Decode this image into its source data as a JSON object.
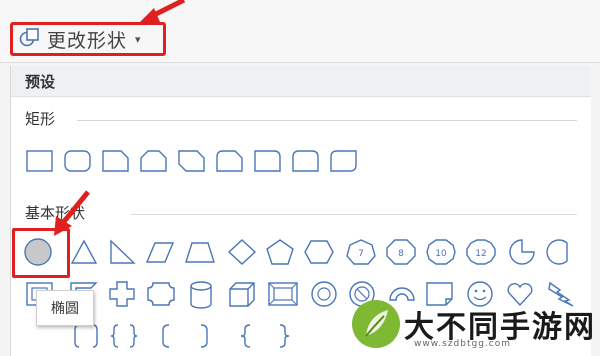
{
  "toolbar": {
    "change_shape_label": "更改形状",
    "dropdown_caret": "▾"
  },
  "panel": {
    "header": "预设",
    "sections": [
      {
        "title": "矩形"
      },
      {
        "title": "基本形状"
      }
    ]
  },
  "tooltip": {
    "text": "椭圆"
  },
  "watermark": {
    "title": "大不同手游网",
    "url": "www.szdbtgg.com"
  },
  "colors": {
    "highlight": "#e02020",
    "shape_stroke": "#4a76b8",
    "selected_fill": "#c8c8c8"
  },
  "icons": {
    "rectangle_shapes": [
      "rectangle-icon",
      "rounded-rectangle-icon",
      "snip-single-corner-rectangle-icon",
      "snip-same-side-corner-rectangle-icon",
      "snip-diagonal-corner-rectangle-icon",
      "snip-round-single-corner-rectangle-icon",
      "round-single-corner-rectangle-icon",
      "round-same-side-corner-rectangle-icon",
      "round-diagonal-corner-rectangle-icon"
    ],
    "basic_shapes_row1": [
      "oval-icon",
      "isosceles-triangle-icon",
      "right-triangle-icon",
      "parallelogram-icon",
      "trapezoid-icon",
      "diamond-icon",
      "pentagon-icon",
      "hexagon-icon",
      "heptagon-icon",
      "octagon-icon",
      "decagon-icon",
      "dodecagon-icon",
      "pie-icon",
      "chord-icon"
    ],
    "basic_shapes_row2": [
      "frame-icon",
      "half-frame-icon",
      "cross-icon",
      "plaque-icon",
      "can-icon",
      "cube-icon",
      "bevel-icon",
      "donut-icon",
      "no-symbol-icon",
      "block-arc-icon",
      "folded-corner-icon",
      "smiley-face-icon",
      "heart-icon",
      "lightning-bolt-icon"
    ],
    "basic_shapes_row3": [
      "double-bracket-icon",
      "double-brace-icon",
      "left-bracket-icon",
      "right-bracket-icon",
      "left-brace-icon",
      "right-brace-icon"
    ]
  }
}
